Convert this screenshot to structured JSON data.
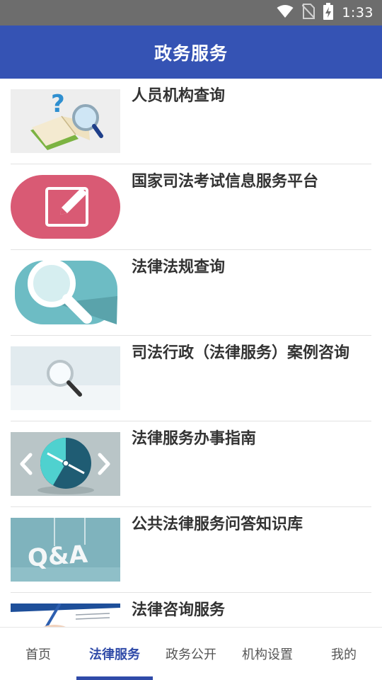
{
  "status_bar": {
    "time": "1:33",
    "icons": [
      "wifi-icon",
      "no-sim-icon",
      "battery-charging-icon"
    ]
  },
  "header": {
    "title": "政务服务",
    "color": "#3553b4"
  },
  "list": {
    "items": [
      {
        "title": "人员机构查询",
        "icon": "book-magnifier-question-thumbnail"
      },
      {
        "title": "国家司法考试信息服务平台",
        "icon": "edit-pen-thumbnail"
      },
      {
        "title": "法律法规查询",
        "icon": "magnifier-thumbnail"
      },
      {
        "title": "司法行政（法律服务）案例咨询",
        "icon": "small-magnifier-thumbnail"
      },
      {
        "title": "法律服务办事指南",
        "icon": "compass-arrows-thumbnail"
      },
      {
        "title": "公共法律服务问答知识库",
        "icon": "qa-thumbnail"
      },
      {
        "title": "法律咨询服务",
        "icon": "handwriting-thumbnail"
      }
    ]
  },
  "tabs": [
    {
      "label": "首页",
      "active": false
    },
    {
      "label": "法律服务",
      "active": true
    },
    {
      "label": "政务公开",
      "active": false
    },
    {
      "label": "机构设置",
      "active": false
    },
    {
      "label": "我的",
      "active": false
    }
  ],
  "accent_color": "#2f4aa8"
}
